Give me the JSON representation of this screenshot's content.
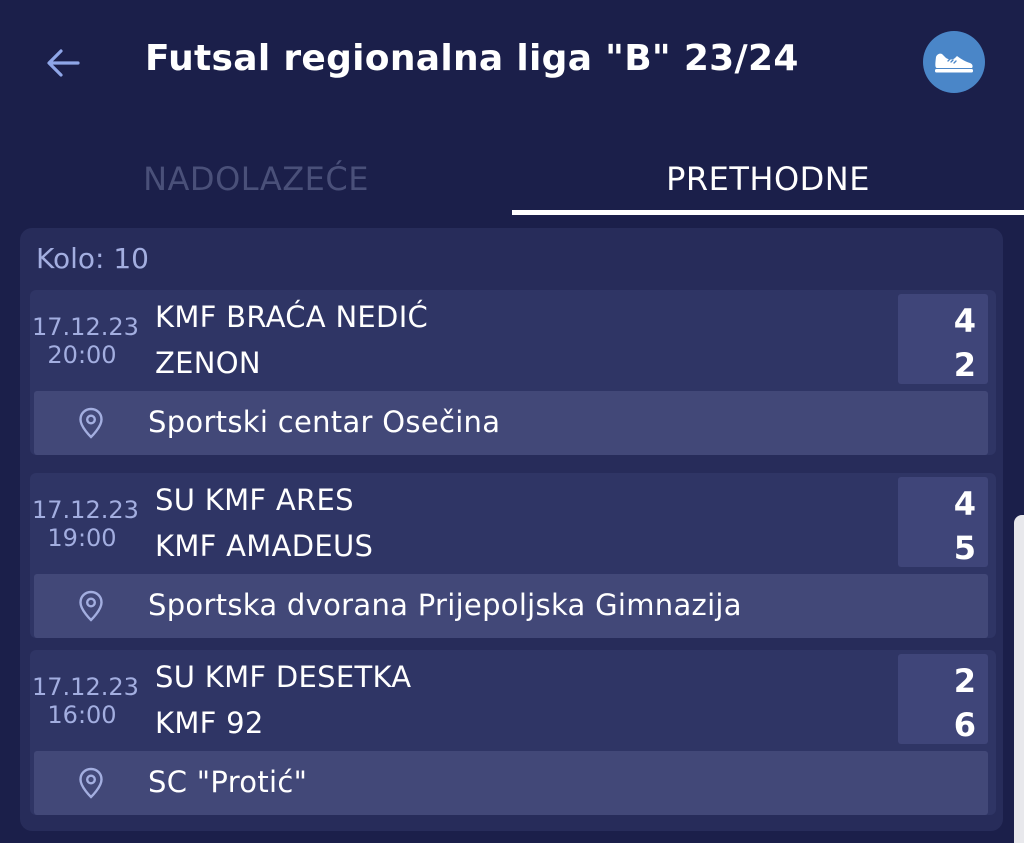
{
  "header": {
    "title": "Futsal regionalna liga \"B\" 23/24",
    "back_icon": "arrow-left-icon",
    "action_icon": "sneaker-icon",
    "action_color": "#4a86c8"
  },
  "tabs": [
    {
      "label": "NADOLAZEĆE",
      "active": false
    },
    {
      "label": "PRETHODNE",
      "active": true
    }
  ],
  "round": {
    "label": "Kolo: 10"
  },
  "matches": [
    {
      "date": "17.12.23",
      "time": "20:00",
      "home_team": "KMF BRAĆA NEDIĆ",
      "away_team": "ZENON",
      "home_score": "4",
      "away_score": "2",
      "venue": "Sportski centar Osečina"
    },
    {
      "date": "17.12.23",
      "time": "19:00",
      "home_team": "SU KMF ARES",
      "away_team": "KMF AMADEUS",
      "home_score": "4",
      "away_score": "5",
      "venue": "Sportska dvorana Prijepoljska Gimnazija"
    },
    {
      "date": "17.12.23",
      "time": "16:00",
      "home_team": "SU KMF DESETKA",
      "away_team": "KMF 92",
      "home_score": "2",
      "away_score": "6",
      "venue": "SC \"Protić\""
    }
  ],
  "colors": {
    "background": "#1b1f4a",
    "panel": "#272c5a",
    "match_card": "#2f3565",
    "venue_bar": "#424878",
    "inactive_tab": "#4a5079",
    "muted_text": "#a3aee0"
  }
}
